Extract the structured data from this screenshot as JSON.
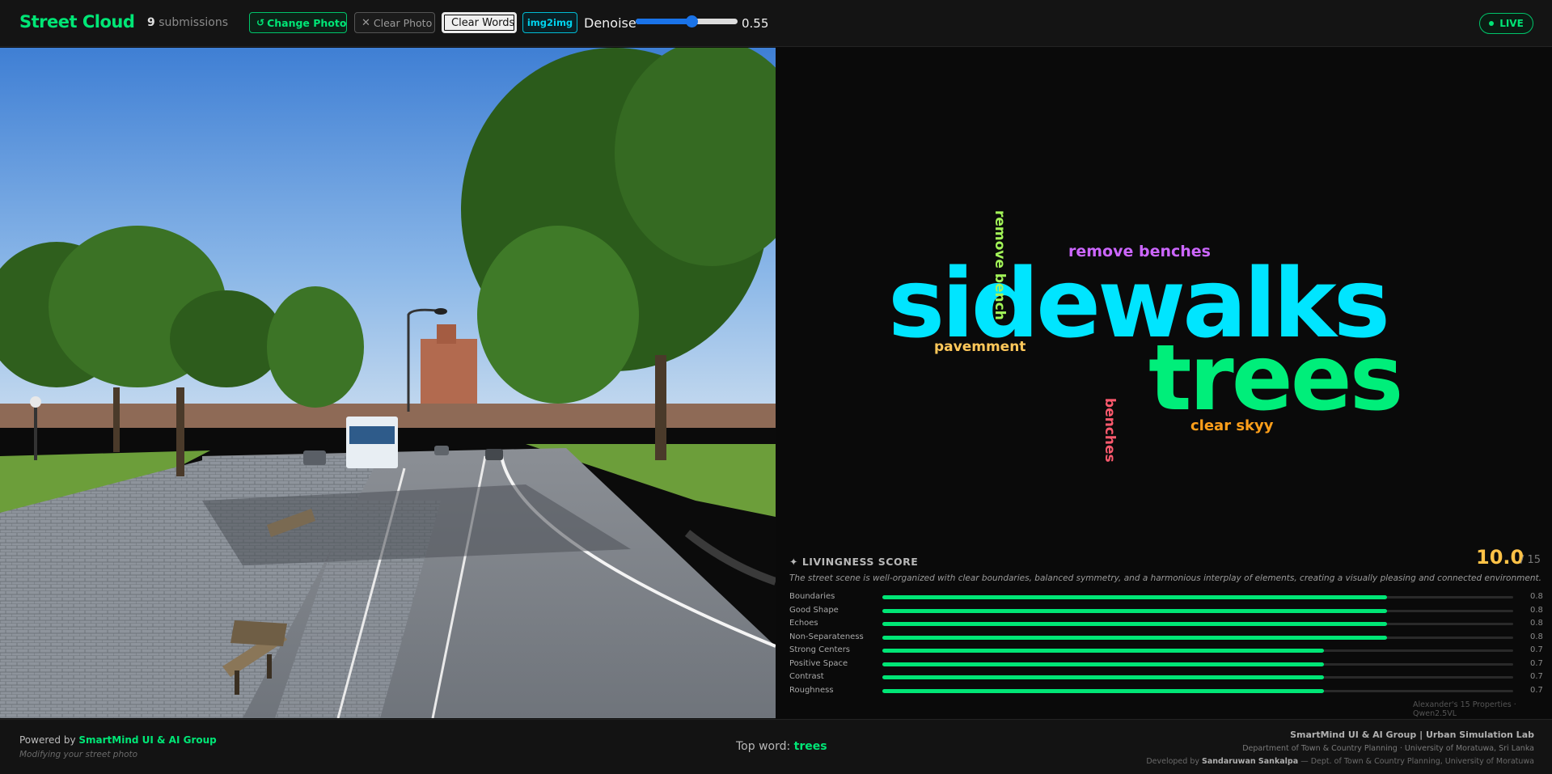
{
  "header": {
    "brand": "Street Cloud",
    "submissions_count": "9",
    "submissions_label": "submissions",
    "change_photo": "Change Photo",
    "clear_photo": "Clear Photo",
    "clear_words": "Clear Words",
    "img2img": "img2img",
    "denoise_label": "Denoise",
    "denoise_value": "0.55",
    "denoise_fraction": 0.55,
    "live": "LIVE"
  },
  "wordcloud": {
    "words": [
      {
        "text": "sidewalks",
        "color": "#00e5ff"
      },
      {
        "text": "trees",
        "color": "#00ee7a"
      },
      {
        "text": "remove benches",
        "color": "#cc66ff"
      },
      {
        "text": "pavemment",
        "color": "#ffc85a"
      },
      {
        "text": "clear skyy",
        "color": "#ff9f1a"
      },
      {
        "text": "remove bench",
        "color": "#a3f558"
      },
      {
        "text": "benches",
        "color": "#ff5a6e"
      }
    ]
  },
  "score": {
    "title": "✦ LIVINGNESS SCORE",
    "value": "10.0",
    "max": "/ 15",
    "description": "The street scene is well-organized with clear boundaries, balanced symmetry, and a harmonious interplay of elements, creating a visually pleasing and connected environment.",
    "properties": [
      {
        "label": "Boundaries",
        "value": "0.8",
        "fraction": 0.8
      },
      {
        "label": "Good Shape",
        "value": "0.8",
        "fraction": 0.8
      },
      {
        "label": "Echoes",
        "value": "0.8",
        "fraction": 0.8
      },
      {
        "label": "Non-Separateness",
        "value": "0.8",
        "fraction": 0.8
      },
      {
        "label": "Strong Centers",
        "value": "0.7",
        "fraction": 0.7
      },
      {
        "label": "Positive Space",
        "value": "0.7",
        "fraction": 0.7
      },
      {
        "label": "Contrast",
        "value": "0.7",
        "fraction": 0.7
      },
      {
        "label": "Roughness",
        "value": "0.7",
        "fraction": 0.7
      }
    ],
    "credit": "Alexander's 15 Properties · Qwen2.5VL"
  },
  "footer": {
    "powered_prefix": "Powered by",
    "powered_name": "SmartMind UI & AI Group",
    "modifying": "Modifying your street photo",
    "topword_prefix": "Top word:",
    "topword": "trees",
    "line1": "SmartMind UI & AI Group  |  Urban Simulation Lab",
    "line2": "Department of Town & Country Planning · University of Moratuwa, Sri Lanka",
    "line3_prefix": "Developed by",
    "line3_name": "Sandaruwan Sankalpa",
    "line3_suffix": "— Dept. of Town & Country Planning, University of Moratuwa"
  },
  "icons": {
    "change_photo": "refresh-icon",
    "clear_photo": "close-icon",
    "live": "live-dot-icon",
    "score": "sparkle-icon"
  }
}
